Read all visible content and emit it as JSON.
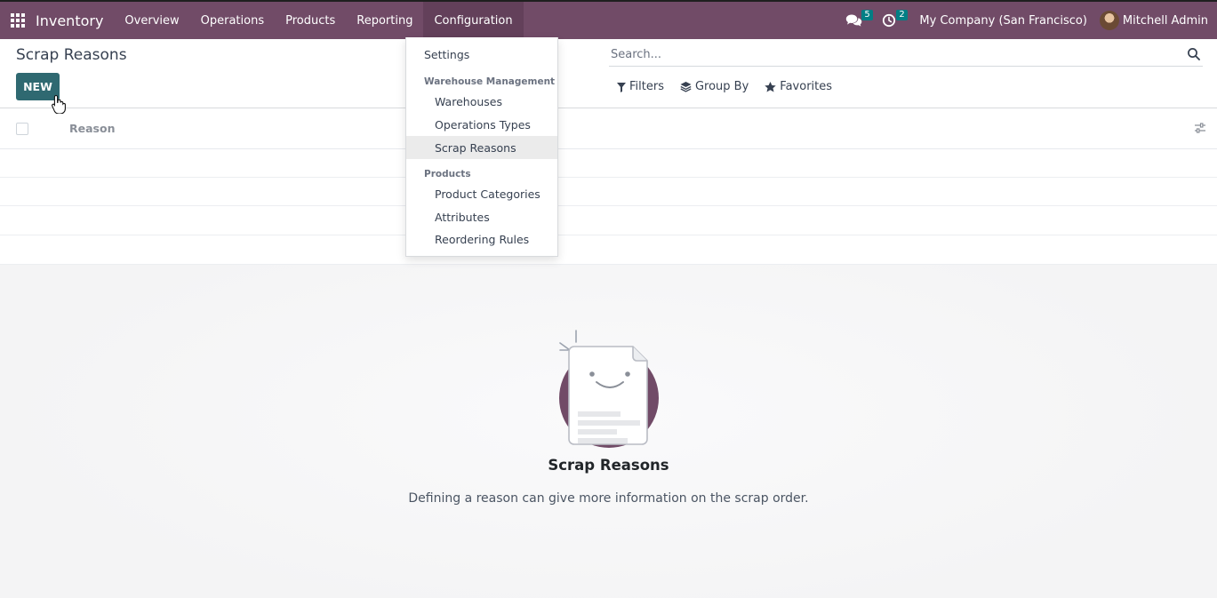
{
  "navbar": {
    "app_name": "Inventory",
    "menu": [
      "Overview",
      "Operations",
      "Products",
      "Reporting",
      "Configuration"
    ],
    "active_menu": "Configuration",
    "messages_count": "5",
    "activities_count": "2",
    "company": "My Company (San Francisco)",
    "user": "Mitchell Admin",
    "icons": {
      "apps": "apps-grid-icon",
      "messages": "chat-icon",
      "activities": "clock-icon"
    }
  },
  "control_panel": {
    "title": "Scrap Reasons",
    "new_label": "NEW",
    "search_placeholder": "Search...",
    "filters_label": "Filters",
    "groupby_label": "Group By",
    "favorites_label": "Favorites"
  },
  "list": {
    "columns": [
      "Reason"
    ]
  },
  "dropdown": {
    "settings": "Settings",
    "section_warehouse": "Warehouse Management",
    "warehouse_items": [
      "Warehouses",
      "Operations Types",
      "Scrap Reasons"
    ],
    "section_products": "Products",
    "product_items": [
      "Product Categories",
      "Attributes",
      "Reordering Rules"
    ],
    "active_item": "Scrap Reasons"
  },
  "empty_state": {
    "title": "Scrap Reasons",
    "text": "Defining a reason can give more information on the scrap order."
  },
  "colors": {
    "navbar": "#714b67",
    "primary_button": "#2f6971",
    "badge": "#017e84"
  }
}
